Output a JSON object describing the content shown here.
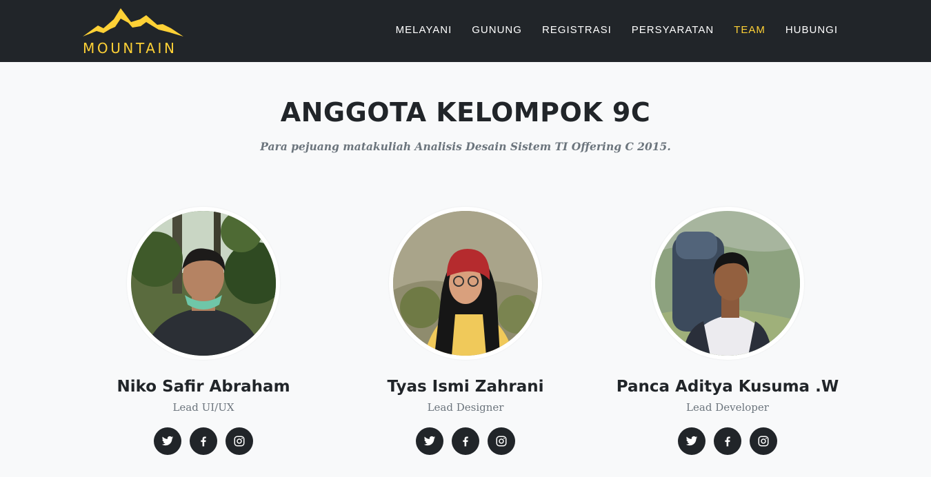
{
  "brand": {
    "name": "MOUNTAIN"
  },
  "nav": {
    "items": [
      {
        "label": "MELAYANI",
        "active": false
      },
      {
        "label": "GUNUNG",
        "active": false
      },
      {
        "label": "REGISTRASI",
        "active": false
      },
      {
        "label": "PERSYARATAN",
        "active": false
      },
      {
        "label": "TEAM",
        "active": true
      },
      {
        "label": "HUBUNGI",
        "active": false
      }
    ]
  },
  "team": {
    "heading": "ANGGOTA KELOMPOK 9C",
    "subheading": "Para pejuang matakuliah Analisis Desain Sistem TI Offering C 2015.",
    "members": [
      {
        "name": "Niko Safir Abraham",
        "role": "Lead UI/UX",
        "social": [
          "twitter-icon",
          "facebook-icon",
          "instagram-icon"
        ]
      },
      {
        "name": "Tyas Ismi Zahrani",
        "role": "Lead Designer",
        "social": [
          "twitter-icon",
          "facebook-icon",
          "instagram-icon"
        ]
      },
      {
        "name": "Panca Aditya Kusuma .W",
        "role": "Lead Developer",
        "social": [
          "twitter-icon",
          "facebook-icon",
          "instagram-icon"
        ]
      }
    ]
  },
  "colors": {
    "navbar_bg": "#212529",
    "accent": "#fed136",
    "page_bg": "#f8f9fa",
    "muted_text": "#6c757d"
  }
}
